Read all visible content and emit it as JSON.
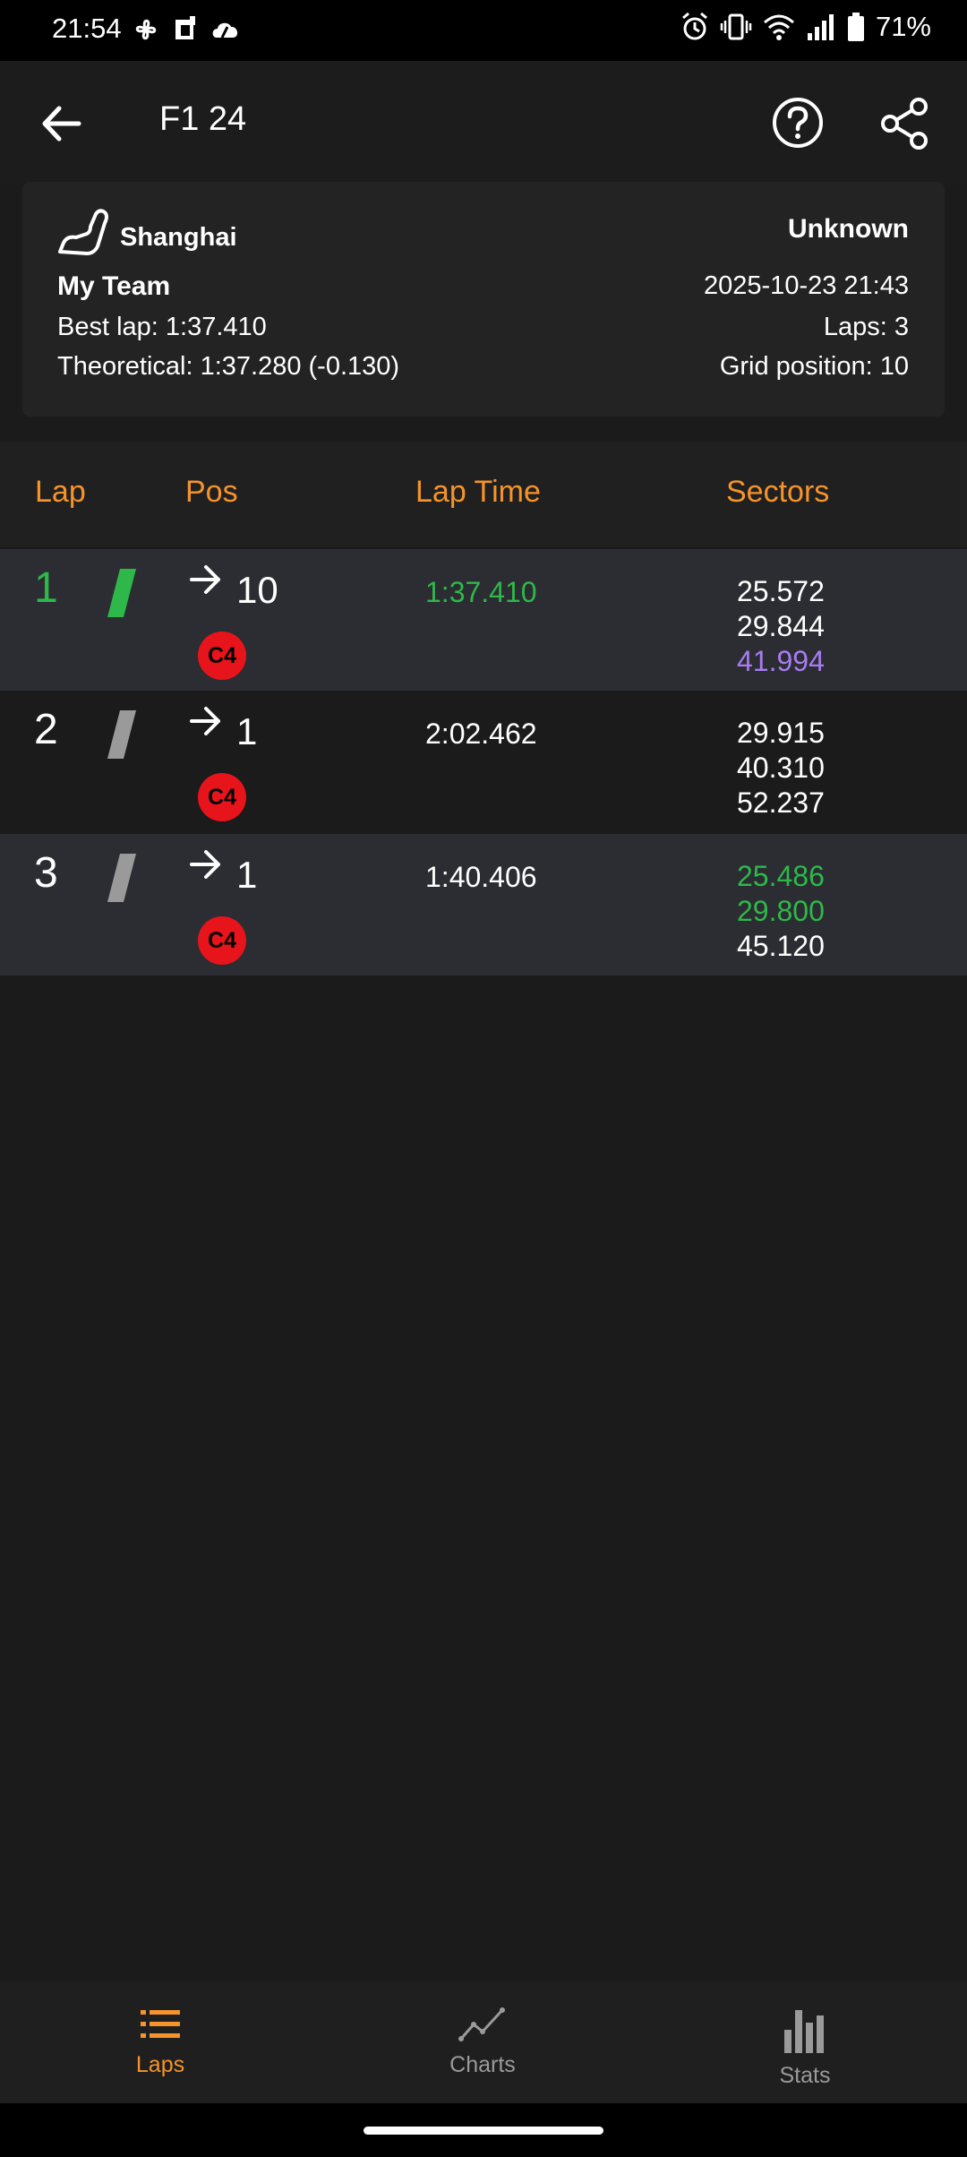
{
  "status_bar": {
    "time": "21:54",
    "battery": "71%"
  },
  "app_bar": {
    "title": "F1 24"
  },
  "session": {
    "track": "Shanghai",
    "weather": "Unknown",
    "team": "My Team",
    "datetime": "2025-10-23 21:43",
    "best_lap": "Best lap: 1:37.410",
    "laps": "Laps: 3",
    "theoretical": "Theoretical: 1:37.280 (-0.130)",
    "grid_position": "Grid position: 10"
  },
  "table": {
    "headers": {
      "lap": "Lap",
      "pos": "Pos",
      "lap_time": "Lap Time",
      "sectors": "Sectors"
    },
    "rows": [
      {
        "lap": "1",
        "pos": "10",
        "compound": "C4",
        "lap_time": "1:37.410",
        "s1": "25.572",
        "s2": "29.844",
        "s3": "41.994"
      },
      {
        "lap": "2",
        "pos": "1",
        "compound": "C4",
        "lap_time": "2:02.462",
        "s1": "29.915",
        "s2": "40.310",
        "s3": "52.237"
      },
      {
        "lap": "3",
        "pos": "1",
        "compound": "C4",
        "lap_time": "1:40.406",
        "s1": "25.486",
        "s2": "29.800",
        "s3": "45.120"
      }
    ]
  },
  "bottom_nav": {
    "laps": "Laps",
    "charts": "Charts",
    "stats": "Stats"
  },
  "colors": {
    "accent": "#f6932a",
    "best": "#2eb84a",
    "purple": "#a77cf0",
    "compound_soft": "#e8141b"
  }
}
